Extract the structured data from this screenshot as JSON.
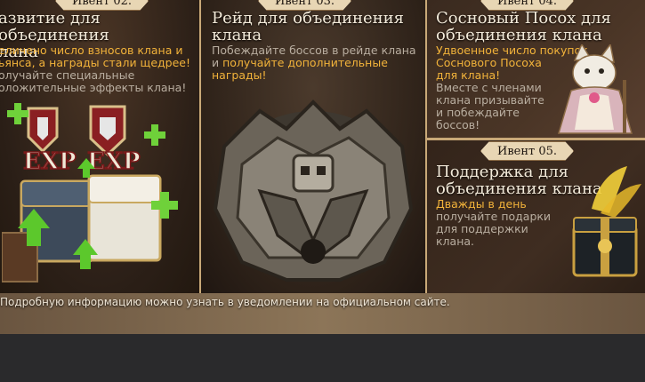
{
  "panels": {
    "p1": {
      "tag": "Ивент 02.",
      "title": [
        "азвитие для объединения",
        "лана"
      ],
      "desc_hl": [
        "еличено число взносов клана и",
        "ьянса, а награды стали щедрее!"
      ],
      "desc": [
        "олучайте специальные",
        "оложительные эффекты клана!"
      ],
      "exp_labels": [
        "EXP",
        "EXP"
      ]
    },
    "p2": {
      "tag": "Ивент 03.",
      "title": [
        "Рейд для объединения",
        "клана"
      ],
      "desc_pre": "Побеждайте боссов в рейде клана",
      "desc_mid_plain": "и ",
      "desc_hl": [
        "получайте дополнительные",
        "награды!"
      ]
    },
    "p3": {
      "tag": "Ивент 04.",
      "title": [
        "Сосновый Посох для",
        "объединения клана"
      ],
      "desc_hl": [
        "Удвоенное число покупок",
        "Соснового Посоха",
        "для клана!"
      ],
      "desc": [
        "Вместе с членами",
        "клана призывайте",
        "и побеждайте",
        "боссов!"
      ]
    },
    "p4": {
      "tag": "Ивент 05.",
      "title": [
        "Поддержка для",
        "объединения клана"
      ],
      "desc_hl": [
        "Дважды в день"
      ],
      "desc": [
        "получайте подарки",
        "для поддержки",
        "клана."
      ]
    }
  },
  "footer": {
    "text": "Подробную информацию можно узнать в уведомлении на официальном сайте."
  },
  "colors": {
    "accent": "#f2b33a",
    "frame": "#c9a978",
    "text": "#f3ead9"
  },
  "icons": [
    "exp-chest-icon",
    "raid-boss-icon",
    "cat-mascot-icon",
    "gift-box-icon"
  ]
}
